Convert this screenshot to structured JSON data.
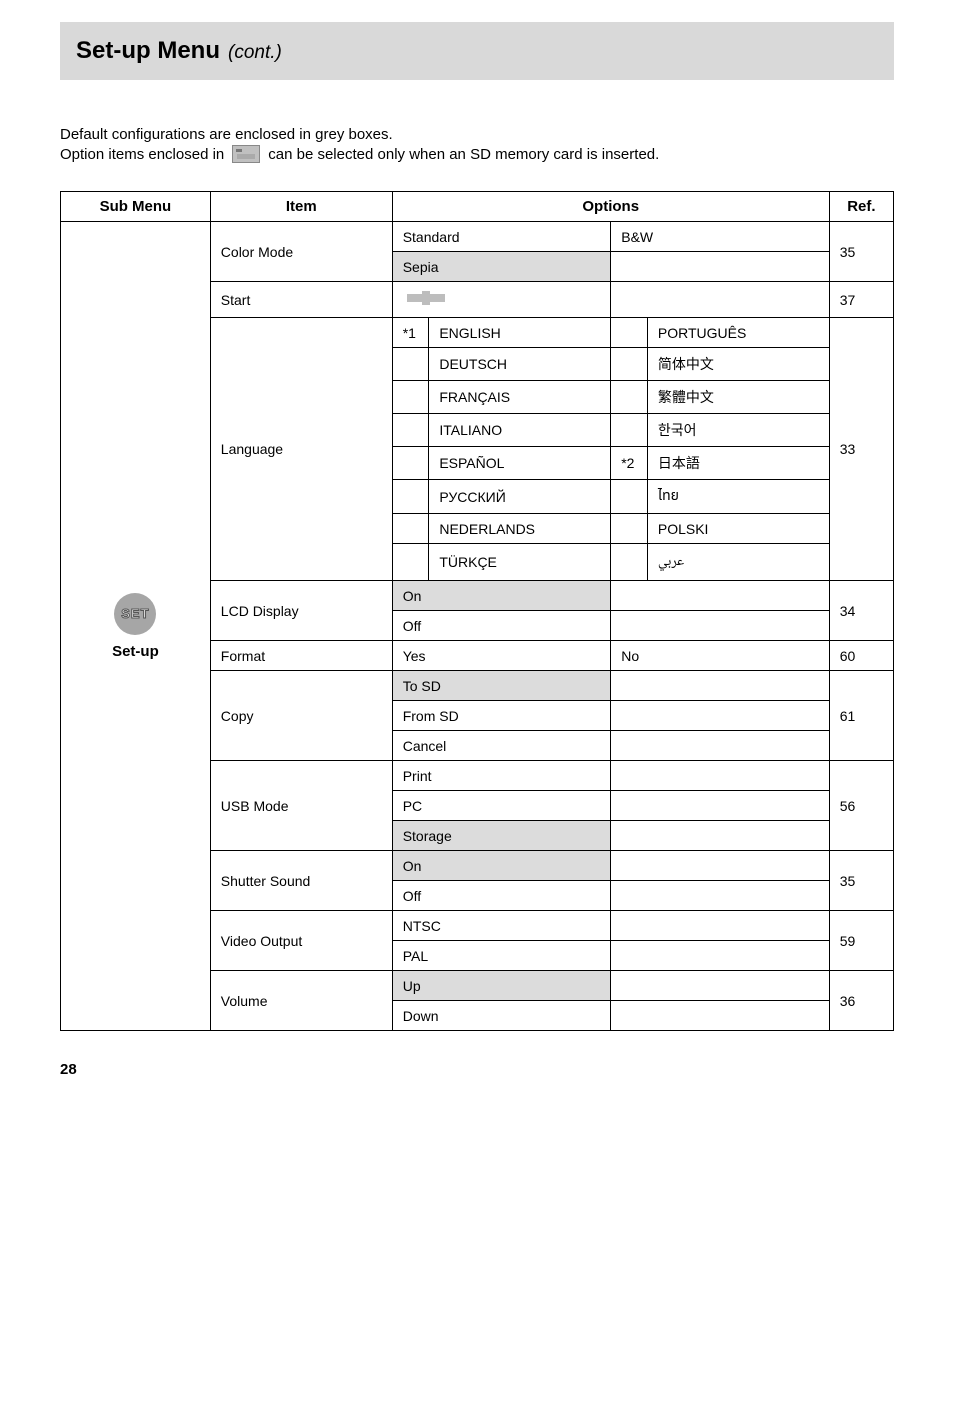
{
  "header": {
    "title_main": "Set-up Menu",
    "title_sub": "(cont.)"
  },
  "intro": {
    "line1": "Default configurations are enclosed in grey boxes.",
    "line2_a": "Option items enclosed in",
    "line2_b": "can be selected only when an SD memory card is inserted."
  },
  "table": {
    "headers": [
      "Sub Menu",
      "Item",
      "Options",
      "Ref."
    ],
    "submenu_label": "Set-up",
    "submenu_icon": "SET",
    "rows": {
      "color": {
        "item": "Color Mode",
        "opts": [
          "Standard",
          "Sepia",
          "B&W"
        ],
        "default": "Sepia",
        "ref": "35"
      },
      "start": {
        "item": "Start",
        "opt_render": "plus-icon",
        "ref": "37"
      },
      "language": {
        "item": "Language",
        "ref": "33",
        "col1": [
          {
            "label": "ENGLISH",
            "mark": "*1"
          },
          {
            "label": "DEUTSCH"
          },
          {
            "label": "FRANÇAIS"
          },
          {
            "label": "ITALIANO"
          },
          {
            "label": "ESPAÑOL"
          },
          {
            "label": "РУССКИЙ"
          },
          {
            "label": "NEDERLANDS"
          },
          {
            "label": "TÜRKÇE"
          }
        ],
        "col2": [
          {
            "label": "PORTUGUÊS"
          },
          {
            "label": "简体中文",
            "class": "script-font"
          },
          {
            "label": "繁體中文",
            "class": "script-font"
          },
          {
            "label": "한국어"
          },
          {
            "label": "日本語",
            "mark": "*2"
          },
          {
            "label": "ไทย",
            "class": "thai"
          },
          {
            "label": "POLSKI"
          },
          {
            "label": "عربي",
            "class": "arabic"
          }
        ]
      },
      "lcd": {
        "item": "LCD Display",
        "opts": [
          "On",
          "Off"
        ],
        "default": "On",
        "ref": "34"
      },
      "format": {
        "item": "Format",
        "opts": [
          "Yes",
          "No"
        ],
        "ref": "60"
      },
      "copy": {
        "item": "Copy",
        "opts": [
          "To SD",
          "From SD",
          "Cancel"
        ],
        "default": "To SD",
        "ref": "61"
      },
      "usb": {
        "item": "USB Mode",
        "opts": [
          "Print",
          "PC",
          "Storage"
        ],
        "default": "Storage",
        "ref": "56"
      },
      "sound": {
        "item": "Shutter Sound",
        "opts": [
          "On",
          "Off"
        ],
        "default": "On",
        "ref": "35"
      },
      "video": {
        "item": "Video Output",
        "opts": [
          "NTSC",
          "PAL"
        ],
        "ref": "59"
      },
      "vol": {
        "item": "Volume",
        "opts": [
          "Up",
          "Down"
        ],
        "default": "Up",
        "ref": "36"
      }
    }
  },
  "page_number": "28"
}
